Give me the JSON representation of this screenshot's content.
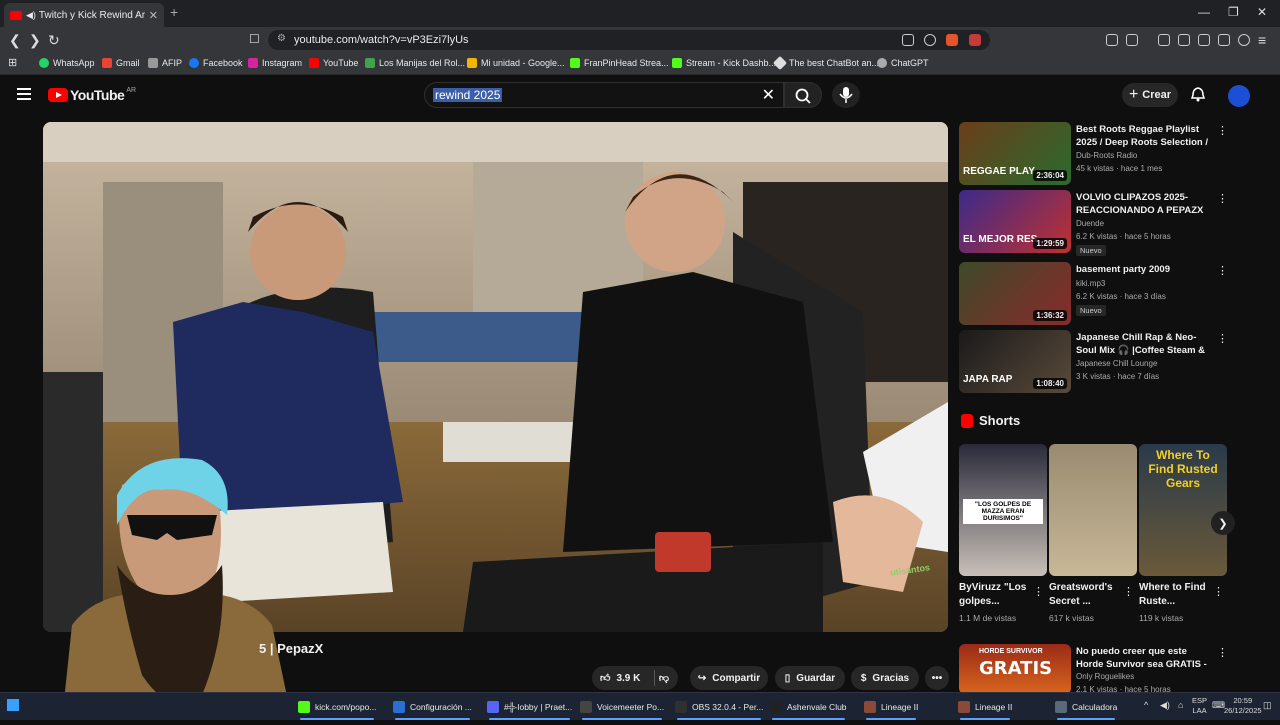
{
  "browser": {
    "tab_title": "Twitch y Kick Rewind Argentin",
    "url": "youtube.com/watch?v=vP3Ezi7lyUs",
    "bookmarks": [
      "WhatsApp",
      "Gmail",
      "AFIP",
      "Facebook",
      "Instagram",
      "YouTube",
      "Los Manijas del Rol...",
      "Mi unidad - Google...",
      "FranPinHead Strea...",
      "Stream - Kick Dashb...",
      "The best ChatBot an...",
      "ChatGPT"
    ]
  },
  "youtube": {
    "logo_text": "YouTube",
    "region": "AR",
    "search_query": "rewind 2025",
    "create_label": "Crear"
  },
  "video": {
    "title_fragment": "5 | PepazX",
    "likes": "3.9 K",
    "share_label": "Compartir",
    "save_label": "Guardar",
    "thanks_label": "Gracias",
    "overlay_text": "utisantos"
  },
  "recommendations": [
    {
      "title": "Best Roots Reggae Playlist 2025 / Deep Roots Selection / ...",
      "channel": "Dub-Roots Radio",
      "meta": "45 k vistas · hace 1 mes",
      "duration": "2:36:04",
      "badge": "",
      "thumb_text": "REGGAE PLAY",
      "colors": [
        "#6b3d1a",
        "#2a6b2e"
      ]
    },
    {
      "title": "VOLVIO CLIPAZOS 2025- REACCIONANDO A PEPAZX",
      "channel": "Duende",
      "meta": "6.2 K vistas · hace 5 horas",
      "duration": "1:29:59",
      "badge": "Nuevo",
      "thumb_text": "EL MEJOR RES",
      "colors": [
        "#3b2a8a",
        "#c03030"
      ]
    },
    {
      "title": "basement party 2009",
      "channel": "kiki.mp3",
      "meta": "6.2 K vistas · hace 3 días",
      "duration": "1:36:32",
      "badge": "Nuevo",
      "thumb_text": "",
      "colors": [
        "#3d4a2a",
        "#8a2a2a"
      ]
    },
    {
      "title": "Japanese Chill Rap & Neo-Soul Mix 🎧 |Coffee Steam & Gentl...",
      "channel": "Japanese Chill Lounge",
      "meta": "3 K vistas · hace 7 días",
      "duration": "1:08:40",
      "badge": "",
      "thumb_text": "JAPA RAP",
      "colors": [
        "#1a1a1a",
        "#5a4a3a"
      ]
    }
  ],
  "shorts": {
    "heading": "Shorts",
    "items": [
      {
        "title": "ByViruzz \"Los golpes...",
        "views": "1.1 M de vistas",
        "thumb_text": "\"LOS GOLPES DE MAZZA ERAN DURISIMOS\"",
        "colors": [
          "#2a2a3a",
          "#c8c0b8"
        ]
      },
      {
        "title": "Greatsword's Secret ...",
        "views": "617 k vistas",
        "thumb_text": "",
        "colors": [
          "#9a8a70",
          "#c8b898"
        ]
      },
      {
        "title": "Where to Find Ruste...",
        "views": "119 k vistas",
        "thumb_text": "Where To Find Rusted Gears",
        "colors": [
          "#2a3a4a",
          "#6a5a3a"
        ]
      }
    ]
  },
  "rec_bottom": {
    "title": "No puedo creer que este Horde Survivor sea GRATIS - Power ...",
    "channel": "Only Roguelikes",
    "meta": "2.1 K vistas · hace 5 horas",
    "thumb_text": "GRATIS",
    "thumb_label": "HORDE SURVIVOR"
  },
  "taskbar": {
    "items": [
      "kick.com/popo...",
      "Configuración ...",
      "#╬-lobby | Praet...",
      "Voicemeeter Po...",
      "OBS 32.0.4 - Per...",
      "Ashenvale Club",
      "Lineage II",
      "Lineage II",
      "Calculadora"
    ],
    "lang": "ESP",
    "lang2": "LAA",
    "time": "20:59",
    "date": "26/12/2025"
  }
}
